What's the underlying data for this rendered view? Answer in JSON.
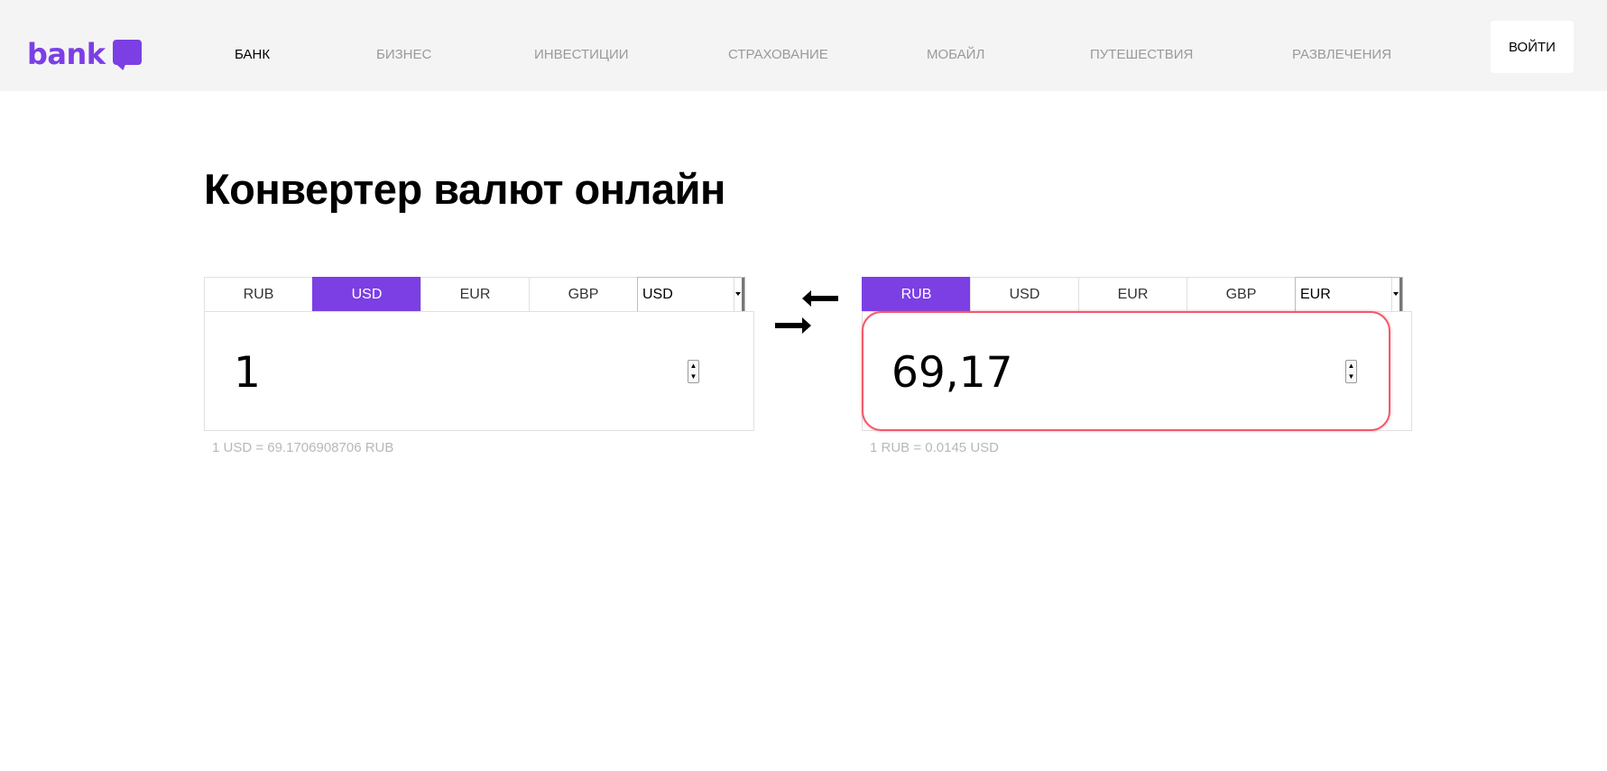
{
  "header": {
    "logo_text": "bank",
    "nav": [
      {
        "label": "БАНК",
        "active": true
      },
      {
        "label": "БИЗНЕС",
        "active": false
      },
      {
        "label": "ИНВЕСТИЦИИ",
        "active": false
      },
      {
        "label": "СТРАХОВАНИЕ",
        "active": false
      },
      {
        "label": "МОБАЙЛ",
        "active": false
      },
      {
        "label": "ПУТЕШЕСТВИЯ",
        "active": false
      },
      {
        "label": "РАЗВЛЕЧЕНИЯ",
        "active": false
      }
    ],
    "login_label": "ВОЙТИ"
  },
  "main": {
    "title": "Конвертер валют онлайн"
  },
  "converter": {
    "from": {
      "tabs": [
        "RUB",
        "USD",
        "EUR",
        "GBP"
      ],
      "active_tab": "USD",
      "select_value": "USD",
      "amount": "1",
      "rate_note": "1 USD = 69.1706908706 RUB"
    },
    "to": {
      "tabs": [
        "RUB",
        "USD",
        "EUR",
        "GBP"
      ],
      "active_tab": "RUB",
      "select_value": "EUR",
      "amount": "69,17",
      "rate_note": "1 RUB = 0.0145 USD"
    },
    "swap_icon": "swap-arrows-icon"
  },
  "colors": {
    "accent": "#7b3fe4",
    "focus_border": "#f05a6a",
    "header_bg": "#f4f4f4",
    "muted_text": "#9a9a9a"
  }
}
